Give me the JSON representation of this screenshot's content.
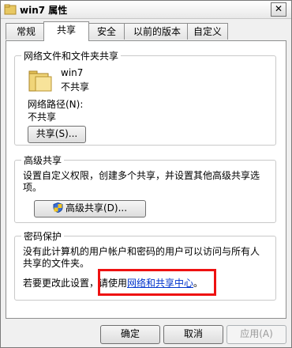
{
  "window": {
    "title": "win7 属性",
    "close_glyph": "✕"
  },
  "tabs": [
    {
      "label": "常规"
    },
    {
      "label": "共享"
    },
    {
      "label": "安全"
    },
    {
      "label": "以前的版本"
    },
    {
      "label": "自定义"
    }
  ],
  "network_share": {
    "legend": "网络文件和文件夹共享",
    "folder_name": "win7",
    "folder_status": "不共享",
    "path_label": "网络路径(N):",
    "path_value": "不共享",
    "share_button": "共享(S)..."
  },
  "advanced_share": {
    "legend": "高级共享",
    "description": "设置自定义权限，创建多个共享，并设置其他高级共享选项。",
    "description_line1": "设置自定义权限，创建多个共享，并设置其他高级共享选",
    "description_line2": "项。",
    "button": "高级共享(D)..."
  },
  "password_protection": {
    "legend": "密码保护",
    "description_line1": "没有此计算机的用户帐户和密码的用户可以访问与所有人",
    "description_line2": "共享的文件夹。",
    "change_prefix": "若要更改此设置，请使用",
    "change_link": "网络和共享中心",
    "change_suffix": "。"
  },
  "buttons": {
    "ok": "确定",
    "cancel": "取消",
    "apply": "应用(A)"
  },
  "colors": {
    "link": "#0033cc",
    "highlight": "#ee1111"
  }
}
